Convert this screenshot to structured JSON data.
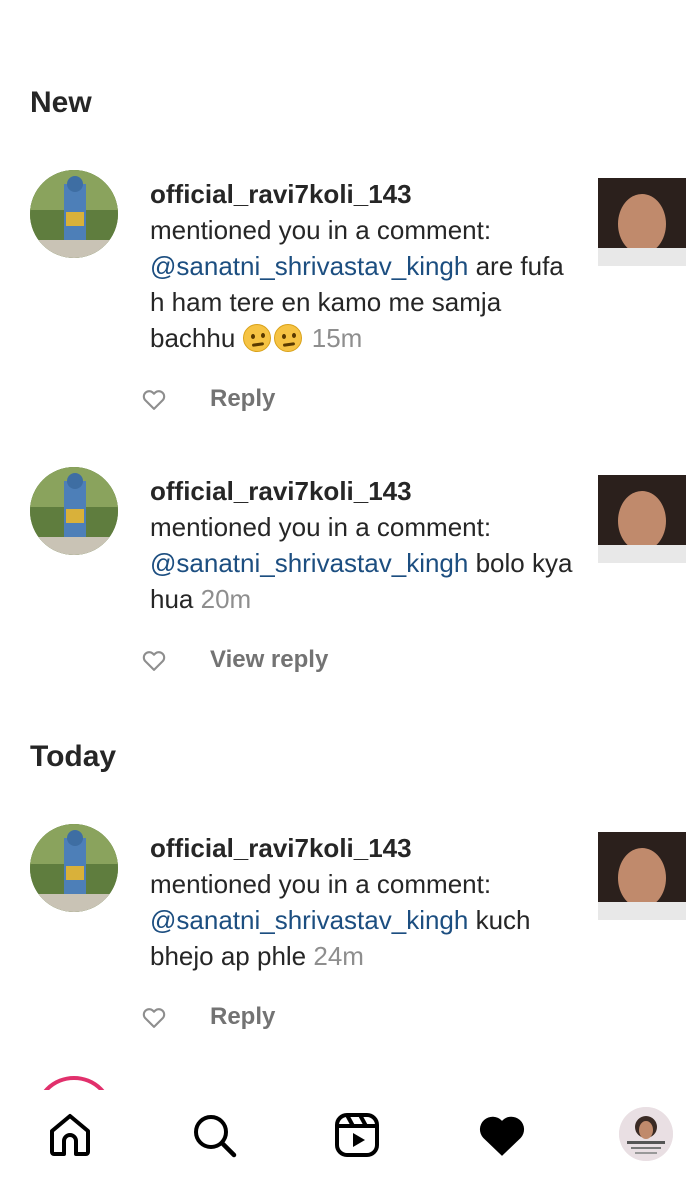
{
  "sections": {
    "new": "New",
    "today": "Today"
  },
  "notifications": [
    {
      "username": "official_ravi7koli_143",
      "action": "mentioned you in a comment:",
      "mention": "@sanatni_shrivastav_kingh",
      "message": " are fufa h ham tere en kamo me samja bachhu ",
      "emoji": [
        "face-with-raised-eyebrow-emoji",
        "face-with-raised-eyebrow-emoji"
      ],
      "time": "15m",
      "reply_label": "Reply"
    },
    {
      "username": "official_ravi7koli_143",
      "action": "mentioned you in a comment:",
      "mention": "@sanatni_shrivastav_kingh",
      "message": " bolo kya hua ",
      "time": "20m",
      "reply_label": "View reply"
    },
    {
      "username": "official_ravi7koli_143",
      "action": "mentioned you in a comment:",
      "mention": "@sanatni_shrivastav_kingh",
      "message": " kuch bhejo ap phle ",
      "time": "24m",
      "reply_label": "Reply"
    }
  ],
  "bottom_nav": [
    {
      "icon": "home-icon"
    },
    {
      "icon": "search-icon"
    },
    {
      "icon": "reels-icon"
    },
    {
      "icon": "heart-filled-icon"
    },
    {
      "icon": "profile-avatar"
    }
  ],
  "colors": {
    "mention": "#1c4e80",
    "time": "#8e8e8e",
    "story_ring": "#e1306c"
  }
}
